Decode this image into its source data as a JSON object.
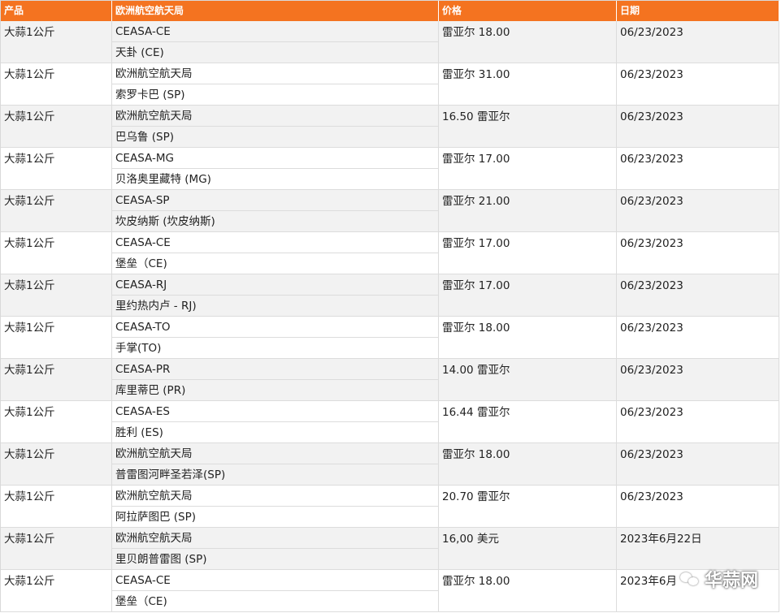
{
  "table": {
    "headers": {
      "product": "产品",
      "market": "欧洲航空航天局",
      "price": "价格",
      "date": "日期"
    },
    "rows": [
      {
        "product": "大蒜1公斤",
        "market": "CEASA-CE",
        "city": "天卦 (CE)",
        "price": "雷亚尔 18.00",
        "date": "06/23/2023"
      },
      {
        "product": "大蒜1公斤",
        "market": "欧洲航空航天局",
        "city": "索罗卡巴 (SP)",
        "price": "雷亚尔 31.00",
        "date": "06/23/2023"
      },
      {
        "product": "大蒜1公斤",
        "market": "欧洲航空航天局",
        "city": "巴乌鲁 (SP)",
        "price": "16.50 雷亚尔",
        "date": "06/23/2023"
      },
      {
        "product": "大蒜1公斤",
        "market": "CEASA-MG",
        "city": "贝洛奥里藏特 (MG)",
        "price": "雷亚尔 17.00",
        "date": "06/23/2023"
      },
      {
        "product": "大蒜1公斤",
        "market": "CEASA-SP",
        "city": "坎皮纳斯 (坎皮纳斯)",
        "price": "雷亚尔 21.00",
        "date": "06/23/2023"
      },
      {
        "product": "大蒜1公斤",
        "market": "CEASA-CE",
        "city": "堡垒（CE)",
        "price": "雷亚尔 17.00",
        "date": "06/23/2023"
      },
      {
        "product": "大蒜1公斤",
        "market": "CEASA-RJ",
        "city": "里约热内卢 - RJ)",
        "price": "雷亚尔 17.00",
        "date": "06/23/2023"
      },
      {
        "product": "大蒜1公斤",
        "market": "CEASA-TO",
        "city": "手掌(TO)",
        "price": "雷亚尔 18.00",
        "date": "06/23/2023"
      },
      {
        "product": "大蒜1公斤",
        "market": "CEASA-PR",
        "city": "库里蒂巴 (PR)",
        "price": "14.00 雷亚尔",
        "date": "06/23/2023"
      },
      {
        "product": "大蒜1公斤",
        "market": "CEASA-ES",
        "city": "胜利 (ES)",
        "price": "16.44 雷亚尔",
        "date": "06/23/2023"
      },
      {
        "product": "大蒜1公斤",
        "market": "欧洲航空航天局",
        "city": "普雷图河畔圣若泽(SP)",
        "price": "雷亚尔 18.00",
        "date": "06/23/2023"
      },
      {
        "product": "大蒜1公斤",
        "market": "欧洲航空航天局",
        "city": "阿拉萨图巴 (SP)",
        "price": "20.70 雷亚尔",
        "date": "06/23/2023"
      },
      {
        "product": "大蒜1公斤",
        "market": "欧洲航空航天局",
        "city": "里贝朗普雷图 (SP)",
        "price": "16,00 美元",
        "date": "2023年6月22日"
      },
      {
        "product": "大蒜1公斤",
        "market": "CEASA-CE",
        "city": "堡垒（CE)",
        "price": "雷亚尔 18.00",
        "date": "2023年6月"
      }
    ]
  },
  "watermark": {
    "text": "华蒜网",
    "icon": "wechat-icon"
  }
}
